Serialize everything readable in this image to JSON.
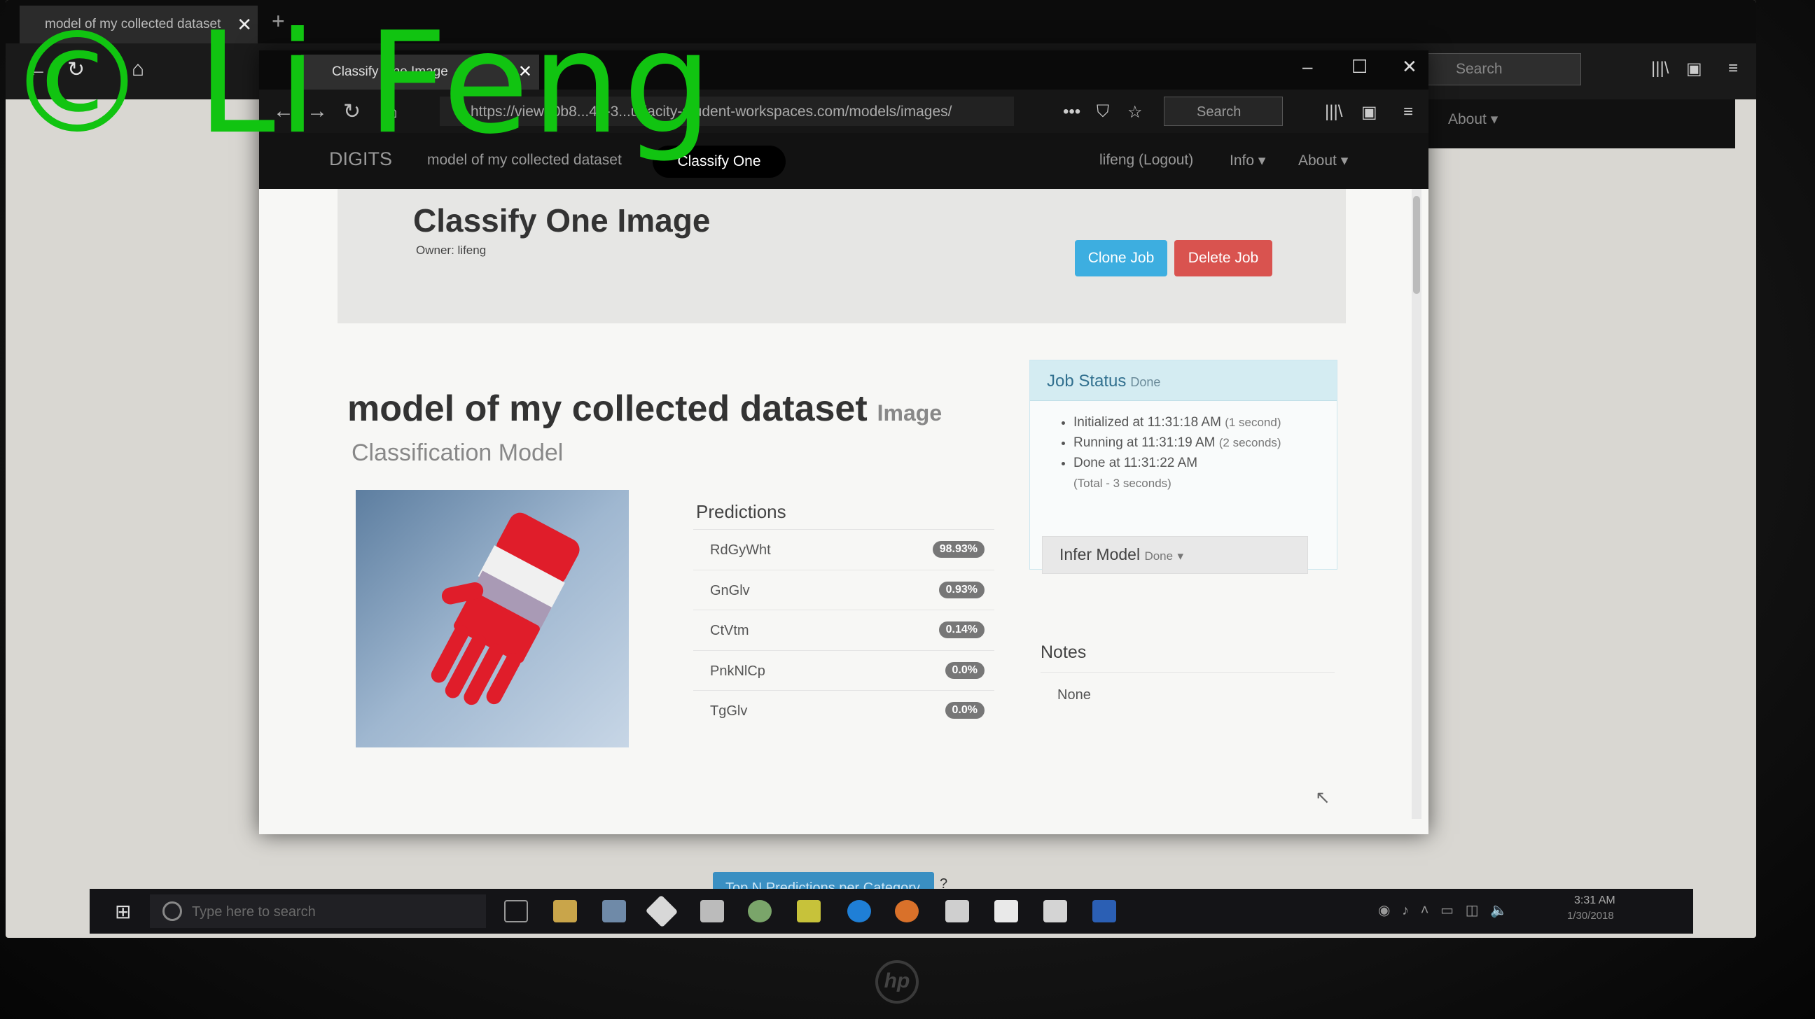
{
  "watermark": "© Li Feng",
  "background_browser": {
    "tab_title": "model of my collected dataset",
    "search_placeholder": "Search",
    "about_label": "About"
  },
  "browser": {
    "tab_title": "Classify One Image",
    "url": "https://view20b8...4e-3...udacity-student-workspaces.com/models/images/",
    "search_placeholder": "Search"
  },
  "navbar": {
    "brand": "DIGITS",
    "breadcrumb_dataset": "model of my collected dataset",
    "breadcrumb_active": "Classify One",
    "user": "lifeng (Logout)",
    "info": "Info",
    "about": "About"
  },
  "job": {
    "title": "Classify One Image",
    "owner": "Owner: lifeng",
    "clone_label": "Clone Job",
    "delete_label": "Delete Job"
  },
  "model": {
    "name": "model of my collected dataset",
    "type": "Image",
    "subtitle": "Classification Model"
  },
  "predictions": {
    "title": "Predictions",
    "rows": [
      {
        "label": "RdGyWht",
        "value": "98.93%"
      },
      {
        "label": "GnGlv",
        "value": "0.93%"
      },
      {
        "label": "CtVtm",
        "value": "0.14%"
      },
      {
        "label": "PnkNlCp",
        "value": "0.0%"
      },
      {
        "label": "TgGlv",
        "value": "0.0%"
      }
    ]
  },
  "job_status": {
    "heading": "Job Status",
    "state": "Done",
    "events": [
      {
        "text": "Initialized at 11:31:18 AM",
        "detail": "(1 second)"
      },
      {
        "text": "Running at 11:31:19 AM",
        "detail": "(2 seconds)"
      },
      {
        "text": "Done at 11:31:22 AM",
        "detail": "(Total - 3 seconds)"
      }
    ],
    "infer_label": "Infer Model",
    "infer_state": "Done"
  },
  "notes": {
    "title": "Notes",
    "value": "None"
  },
  "bottom_button": "Top N Predictions per Category",
  "taskbar": {
    "search_placeholder": "Type here to search",
    "time": "3:31 AM",
    "date": "1/30/2018"
  },
  "colors": {
    "watermark": "#11c411",
    "clone_button": "#3daee0",
    "delete_button": "#d9534f",
    "status_heading": "#d4ecf2"
  }
}
